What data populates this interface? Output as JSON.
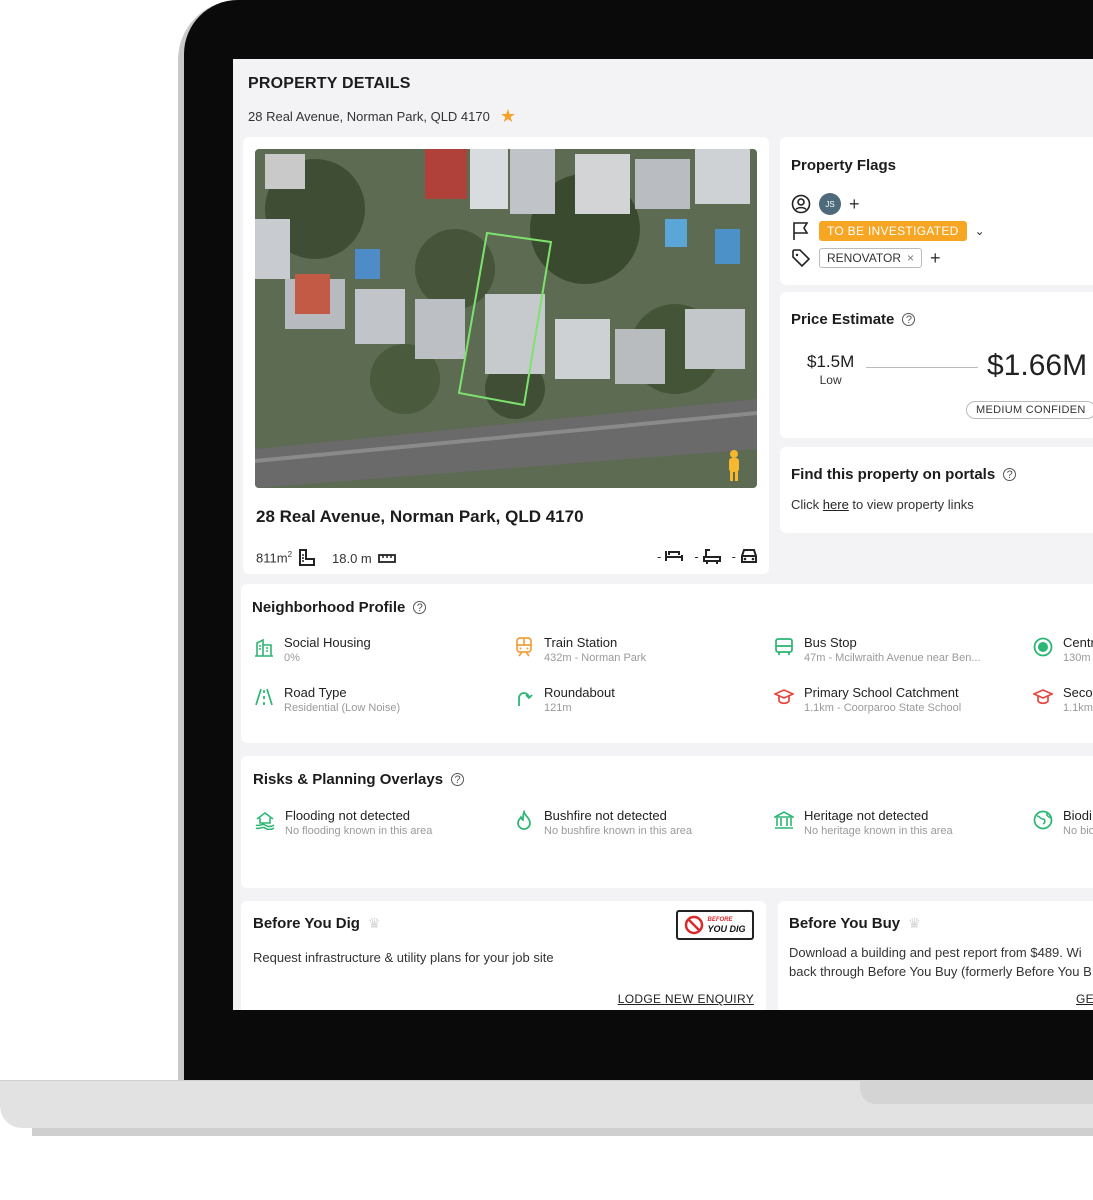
{
  "page": {
    "title": "PROPERTY DETAILS",
    "subtitle": "28 Real Avenue, Norman Park, QLD 4170"
  },
  "property": {
    "address": "28 Real Avenue, Norman Park, QLD 4170",
    "land_area": "811m",
    "land_area_sup": "2",
    "frontage": "18.0 m",
    "bedrooms": "-",
    "bathrooms": "-",
    "car_spaces": "-"
  },
  "flags": {
    "heading": "Property Flags",
    "assignee_initials": "JS",
    "status": "TO BE INVESTIGATED",
    "tag": "RENOVATOR",
    "add_symbol": "+",
    "status_color": "#f6a623"
  },
  "price": {
    "heading": "Price Estimate",
    "low_value": "$1.5M",
    "low_label": "Low",
    "mid_value": "$1.66M",
    "confidence": "MEDIUM CONFIDEN"
  },
  "portals": {
    "heading": "Find this property on portals",
    "text_before": "Click ",
    "link": "here",
    "text_after": " to view property links"
  },
  "neighborhood": {
    "heading": "Neighborhood Profile",
    "items": [
      {
        "label": "Social Housing",
        "sub": "0%",
        "icon": "building-icon"
      },
      {
        "label": "Train Station",
        "sub": "432m - Norman Park",
        "icon": "train-icon"
      },
      {
        "label": "Bus Stop",
        "sub": "47m - Mcilwraith Avenue near Ben...",
        "icon": "bus-icon"
      },
      {
        "label": "Centr",
        "sub": "130m",
        "icon": "target-icon"
      },
      {
        "label": "Road Type",
        "sub": "Residential (Low Noise)",
        "icon": "road-icon"
      },
      {
        "label": "Roundabout",
        "sub": "121m",
        "icon": "roundabout-icon"
      },
      {
        "label": "Primary School Catchment",
        "sub": "1.1km - Coorparoo State School",
        "icon": "school-icon"
      },
      {
        "label": "Secor",
        "sub": "1.1km",
        "icon": "school-icon"
      }
    ]
  },
  "risks": {
    "heading": "Risks & Planning Overlays",
    "items": [
      {
        "label": "Flooding not detected",
        "sub": "No flooding known in this area",
        "icon": "flood-icon"
      },
      {
        "label": "Bushfire not detected",
        "sub": "No bushfire known in this area",
        "icon": "fire-icon"
      },
      {
        "label": "Heritage not detected",
        "sub": "No heritage known in this area",
        "icon": "heritage-icon"
      },
      {
        "label": "Biodi",
        "sub": "No bio",
        "icon": "globe-icon"
      }
    ]
  },
  "dig": {
    "heading": "Before You Dig",
    "text": "Request infrastructure & utility plans for your job site",
    "action": "LODGE NEW ENQUIRY",
    "logo_top": "BEFORE",
    "logo_bottom": "YOU DIG"
  },
  "buy": {
    "heading": "Before You Buy",
    "line1": "Download a building and pest report from $489. Wi",
    "line2": "back through Before You Buy (formerly Before You B",
    "action": "GE"
  },
  "colors": {
    "accent_green": "#2bb673",
    "accent_orange": "#f0a03c",
    "accent_red": "#e8473d"
  }
}
